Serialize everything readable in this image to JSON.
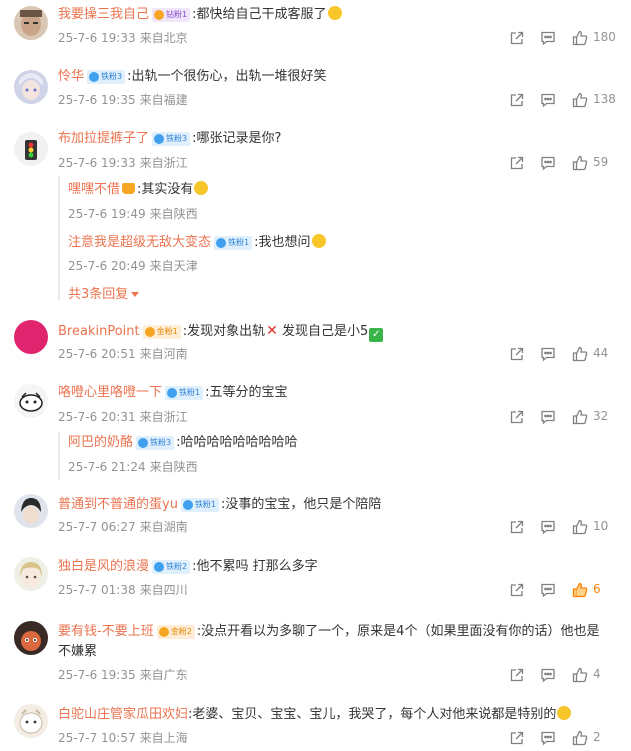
{
  "comments": [
    {
      "username": "我要操三我自己",
      "badge": "钻粉1",
      "text": ":都快给自己干成客服了",
      "time": "25-7-6 19:33",
      "from": "来自北京",
      "likes": "180"
    },
    {
      "username": "怜华",
      "badge": "铁粉3",
      "text": ":出轨一个很伤心，出轨一堆很好笑",
      "time": "25-7-6 19:35",
      "from": "来自福建",
      "likes": "138"
    },
    {
      "username": "布加拉提裤子了",
      "badge": "铁粉3",
      "text": ":哪张记录是你?",
      "time": "25-7-6 19:33",
      "from": "来自浙江",
      "likes": "59",
      "replies": [
        {
          "username": "嘿嘿不借",
          "text": ":其实没有",
          "time": "25-7-6 19:49",
          "from": "来自陕西"
        },
        {
          "username": "注意我是超级无敌大变态",
          "badge": "铁粉1",
          "text": ":我也想问",
          "time": "25-7-6 20:49",
          "from": "来自天津"
        }
      ],
      "more_replies": "共3条回复"
    },
    {
      "username": "BreakinPoint",
      "badge": "金粉1",
      "text": ":发现对象出轨",
      "text2": " 发现自己是小5",
      "time": "25-7-6 20:51",
      "from": "来自河南",
      "likes": "44"
    },
    {
      "username": "咯噔心里咯噔一下",
      "badge": "铁粉1",
      "text": ":五等分的宝宝",
      "time": "25-7-6 20:31",
      "from": "来自浙江",
      "likes": "32",
      "replies": [
        {
          "username": "阿巴的奶酪",
          "badge": "铁粉3",
          "text": ":哈哈哈哈哈哈哈哈哈",
          "time": "25-7-6 21:24",
          "from": "来自陕西"
        }
      ]
    },
    {
      "username": "普通到不普通的蛋yu",
      "badge": "铁粉1",
      "text": ":没事的宝宝，他只是个陪陪",
      "time": "25-7-7 06:27",
      "from": "来自湖南",
      "likes": "10"
    },
    {
      "username": "独白是风的浪漫",
      "badge": "铁粉2",
      "text": ":他不累吗 打那么多字",
      "time": "25-7-7 01:38",
      "from": "来自四川",
      "likes": "6"
    },
    {
      "username": "要有钱-不要上班",
      "badge": "金粉2",
      "text": ":没点开看以为多聊了一个，原来是4个（如果里面没有你的话）他也是",
      "text_cont": "不嫌累",
      "time": "25-7-6 19:35",
      "from": "来自广东",
      "likes": "4"
    },
    {
      "username": "白驼山庄管家瓜田欢妇",
      "text": ":老婆、宝贝、宝宝、宝儿，我哭了，每个人对他来说都是特别的",
      "time": "25-7-7 10:57",
      "from": "来自上海",
      "likes": "2"
    }
  ],
  "colors": {
    "username": "#eb7350",
    "meta": "#939393",
    "liked": "#ff8200"
  }
}
